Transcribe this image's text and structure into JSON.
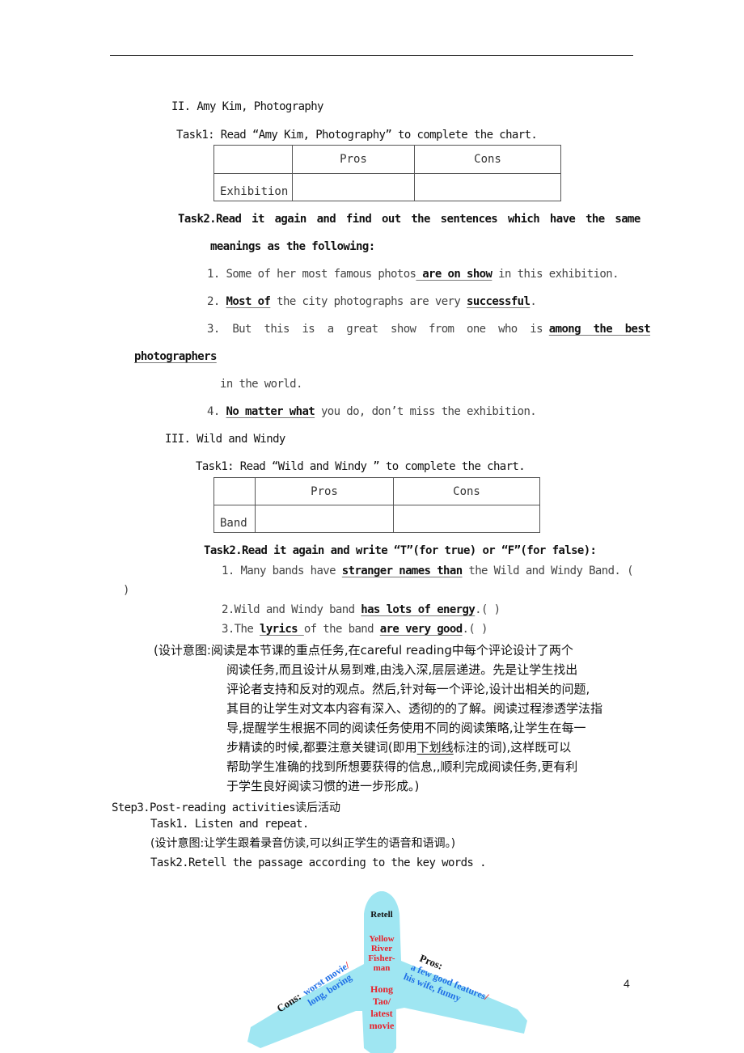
{
  "page_number": "4",
  "section2": {
    "heading": "II. Amy Kim, Photography",
    "task1": "Task1: Read “Amy Kim, Photography” to complete the chart.",
    "chart": {
      "headers": [
        "",
        "Pros",
        "Cons"
      ],
      "row_label": "Exhibition"
    },
    "task2_line1": "Task2.Read it again and find out the sentences which have the same",
    "task2_line2": "meanings as the following:",
    "items": [
      {
        "n": "1.",
        "pre": "Some of her most famous photos",
        "u1": " are on show",
        "post": " in this exhibition."
      },
      {
        "n": "2.",
        "u1": "Most of",
        "mid": " the city photographs are very ",
        "u2": "successful",
        "post": "."
      },
      {
        "n": "3.",
        "pre": "But  this  is  a  great  show  from  one  who  is ",
        "u1": "among  the  best",
        "wrap_u": "photographers",
        "wrap_post": "in the world."
      },
      {
        "n": "4.",
        "u1": "No matter what",
        "post": " you do, don’t miss the exhibition."
      }
    ]
  },
  "section3": {
    "heading": "III. Wild and Windy",
    "task1": "Task1: Read “Wild and Windy ” to complete the chart.",
    "chart": {
      "headers": [
        "",
        "Pros",
        "Cons"
      ],
      "row_label": "Band"
    },
    "task2": "Task2.Read it again and write “T”(for true) or “F”(for false):",
    "items": [
      {
        "n": "1.",
        "pre": "Many bands have ",
        "u1": "stranger names than",
        "post": " the Wild and Windy Band. (",
        "wrap": ")"
      },
      {
        "n": "2.",
        "pre": "Wild and Windy band ",
        "u1": "has lots of energy",
        "post": ".(   )"
      },
      {
        "n": "3.",
        "pre": "The ",
        "u1": "lyrics ",
        "mid": "of the band ",
        "u2": "are very good",
        "post": ".(   )"
      }
    ]
  },
  "design_note": {
    "lines": [
      "(设计意图:阅读是本节课的重点任务,在careful reading中每个评论设计了两个",
      "阅读任务,而且设计从易到难,由浅入深,层层递进。先是让学生找出",
      "评论者支持和反对的观点。然后,针对每一个评论,设计出相关的问题,",
      "其目的让学生对文本内容有深入、透彻的的了解。阅读过程渗透学法指",
      "导,提醒学生根据不同的阅读任务使用不同的阅读策略,让学生在每一",
      "帮助学生准确的找到所想要获得的信息,,顺利完成阅读任务,更有利",
      "于学生良好阅读习惯的进一步形成。)"
    ],
    "line6_pre": "步精读的时候,都要注意关键词(即用",
    "line6_u": "下划线",
    "line6_post": "标注的词),这样既可以"
  },
  "step3": {
    "heading": "Step3.Post-reading activities",
    "heading_cn": "读后活动",
    "task1": "Task1. Listen and repeat.",
    "task1_note": "(设计意图:让学生跟着录音仿读,可以纠正学生的语音和语调。)",
    "task2": "Task2.Retell the passage according to the key words ."
  },
  "diagram": {
    "title": "Retell",
    "center_top": [
      "Yellow",
      "River",
      "Fisher-",
      "man"
    ],
    "center_bottom": [
      "Hong",
      "Tao/",
      "latest",
      "movie"
    ],
    "cons_label": "Cons:",
    "cons_lines": [
      "worst movie",
      "long, boring"
    ],
    "pros_label": "Pros:",
    "pros_lines": [
      "a few good features",
      "his wife, funny"
    ],
    "colors": {
      "plane": "#9fe6f2",
      "red": "#e8202a",
      "blue": "#1f6fe6",
      "black": "#111111"
    }
  }
}
